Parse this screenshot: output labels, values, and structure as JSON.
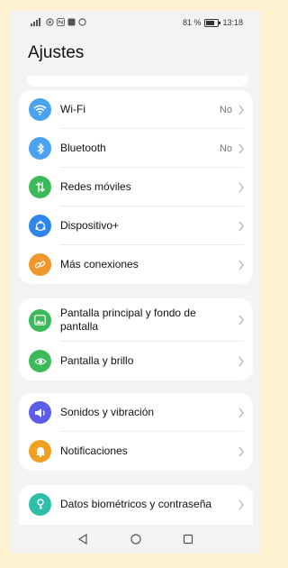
{
  "status": {
    "battery": "81 %",
    "time": "13:18"
  },
  "page": {
    "title": "Ajustes"
  },
  "groups": [
    {
      "items": [
        {
          "label": "Wi-Fi",
          "value": "No",
          "icon": "wifi-icon",
          "color": "#4aa3f0"
        },
        {
          "label": "Bluetooth",
          "value": "No",
          "icon": "bluetooth-icon",
          "color": "#4aa3f0"
        },
        {
          "label": "Redes móviles",
          "value": "",
          "icon": "mobile-data-icon",
          "color": "#3cba5a"
        },
        {
          "label": "Dispositivo+",
          "value": "",
          "icon": "device-plus-icon",
          "color": "#2f86e8"
        },
        {
          "label": "Más conexiones",
          "value": "",
          "icon": "link-icon",
          "color": "#f0962c"
        }
      ]
    },
    {
      "items": [
        {
          "label": "Pantalla principal y fondo de pantalla",
          "value": "",
          "icon": "wallpaper-icon",
          "color": "#3cba5a"
        },
        {
          "label": "Pantalla y brillo",
          "value": "",
          "icon": "eye-icon",
          "color": "#3cba5a"
        }
      ]
    },
    {
      "items": [
        {
          "label": "Sonidos y vibración",
          "value": "",
          "icon": "sound-icon",
          "color": "#5b5ce8"
        },
        {
          "label": "Notificaciones",
          "value": "",
          "icon": "bell-icon",
          "color": "#f0a020"
        }
      ]
    },
    {
      "items": [
        {
          "label": "Datos biométricos y contraseña",
          "value": "",
          "icon": "key-icon",
          "color": "#2dbfa8"
        }
      ]
    }
  ]
}
